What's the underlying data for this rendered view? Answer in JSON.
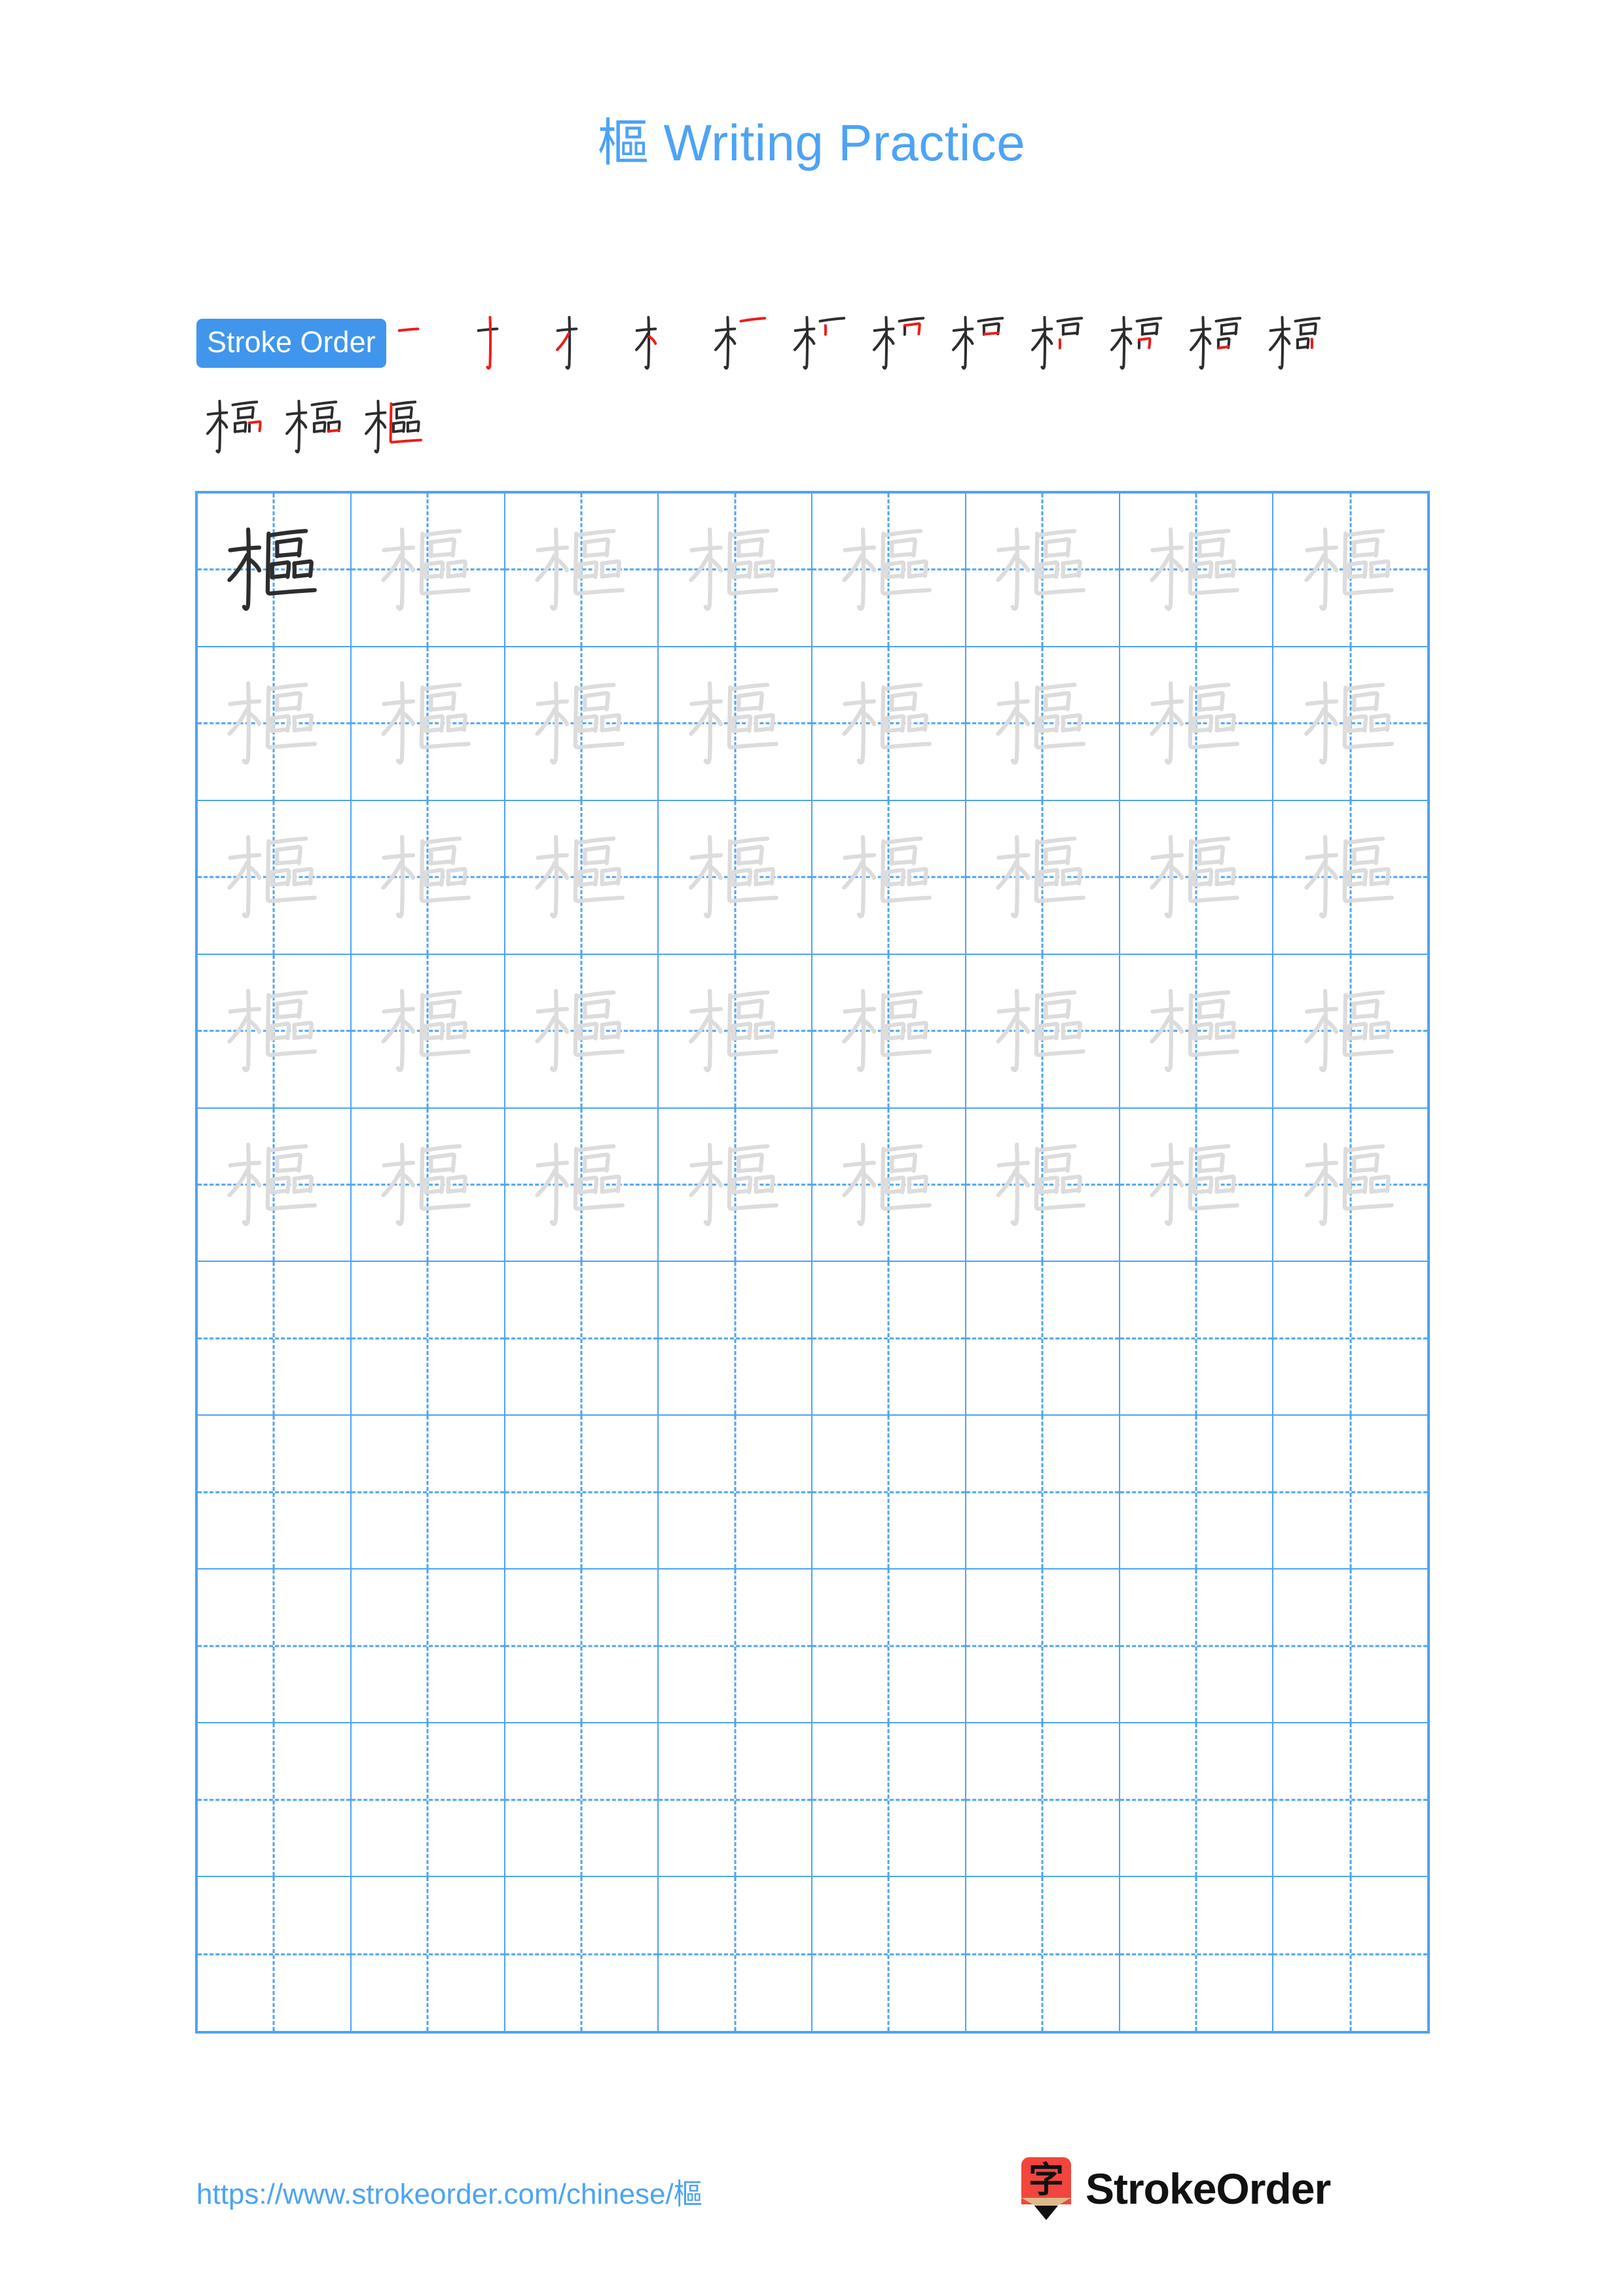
{
  "character": "樞",
  "title": {
    "hanzi": "樞",
    "text": " Writing Practice",
    "color": "#4da3f5"
  },
  "stroke_order": {
    "badge_label": "Stroke Order",
    "badge_bg": "#4096ed",
    "badge_text_color": "#ffffff",
    "total_strokes": 15,
    "new_stroke_color": "#ee1b17",
    "prior_stroke_color": "#2d2d2d",
    "row1_count": 12,
    "row2_count": 3,
    "steps": [
      {
        "index": 1,
        "strokes_shown": 1
      },
      {
        "index": 2,
        "strokes_shown": 2
      },
      {
        "index": 3,
        "strokes_shown": 3
      },
      {
        "index": 4,
        "strokes_shown": 4
      },
      {
        "index": 5,
        "strokes_shown": 5
      },
      {
        "index": 6,
        "strokes_shown": 6
      },
      {
        "index": 7,
        "strokes_shown": 7
      },
      {
        "index": 8,
        "strokes_shown": 8
      },
      {
        "index": 9,
        "strokes_shown": 9
      },
      {
        "index": 10,
        "strokes_shown": 10
      },
      {
        "index": 11,
        "strokes_shown": 11
      },
      {
        "index": 12,
        "strokes_shown": 12
      },
      {
        "index": 13,
        "strokes_shown": 13
      },
      {
        "index": 14,
        "strokes_shown": 14
      },
      {
        "index": 15,
        "strokes_shown": 15
      }
    ]
  },
  "grid": {
    "columns": 8,
    "rows": 10,
    "line_color": "#4da3f5",
    "filled_rows": 5,
    "dark_char_color": "#2d2d2d",
    "trace_char_color": "#dcdcdc",
    "cells": [
      [
        "dark",
        "trace",
        "trace",
        "trace",
        "trace",
        "trace",
        "trace",
        "trace"
      ],
      [
        "trace",
        "trace",
        "trace",
        "trace",
        "trace",
        "trace",
        "trace",
        "trace"
      ],
      [
        "trace",
        "trace",
        "trace",
        "trace",
        "trace",
        "trace",
        "trace",
        "trace"
      ],
      [
        "trace",
        "trace",
        "trace",
        "trace",
        "trace",
        "trace",
        "trace",
        "trace"
      ],
      [
        "trace",
        "trace",
        "trace",
        "trace",
        "trace",
        "trace",
        "trace",
        "trace"
      ],
      [
        "empty",
        "empty",
        "empty",
        "empty",
        "empty",
        "empty",
        "empty",
        "empty"
      ],
      [
        "empty",
        "empty",
        "empty",
        "empty",
        "empty",
        "empty",
        "empty",
        "empty"
      ],
      [
        "empty",
        "empty",
        "empty",
        "empty",
        "empty",
        "empty",
        "empty",
        "empty"
      ],
      [
        "empty",
        "empty",
        "empty",
        "empty",
        "empty",
        "empty",
        "empty",
        "empty"
      ],
      [
        "empty",
        "empty",
        "empty",
        "empty",
        "empty",
        "empty",
        "empty",
        "empty"
      ]
    ]
  },
  "footer": {
    "url_prefix": "https://www.strokeorder.com/chinese/",
    "url_hanzi": "樞",
    "url_color": "#4da3f5",
    "logo_hanzi": "字",
    "logo_text": "StrokeOrder",
    "logo_red": "#f1453d",
    "logo_wood": "#dfb98a"
  }
}
